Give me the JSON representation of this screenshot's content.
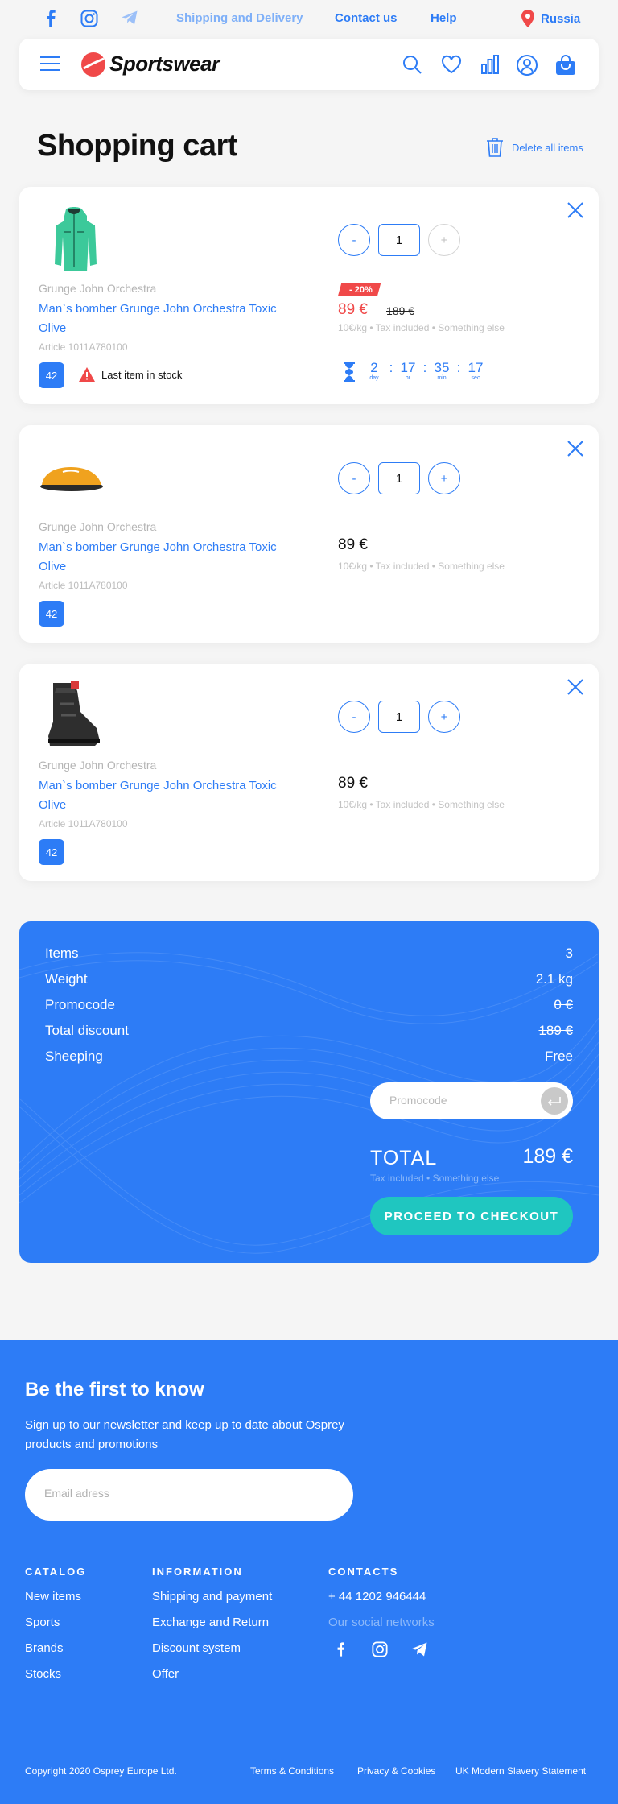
{
  "topbar": {
    "links": [
      "Shipping and Delivery",
      "Contact us",
      "Help"
    ],
    "region": "Russia",
    "social": [
      "facebook-icon",
      "instagram-icon",
      "telegram-icon"
    ]
  },
  "header": {
    "logo_text": "Sportswear",
    "icons": [
      "menu-icon",
      "search-icon",
      "heart-icon",
      "compare-icon",
      "user-icon",
      "bag-icon"
    ]
  },
  "page": {
    "title": "Shopping cart",
    "delete_all": "Delete all items"
  },
  "cart": {
    "items": [
      {
        "brand": "Grunge John Orchestra",
        "name": "Man`s bomber Grunge John Orchestra Toxic Olive",
        "article": "Article 1011A780100",
        "size": "42",
        "qty_minus": "-",
        "quantity": "1",
        "qty_plus": "+",
        "discount_badge": "- 20%",
        "price": "89 €",
        "old_price": "189 €",
        "price_info": "10€/kg • Tax included • Something else",
        "stock_note": "Last item in stock",
        "timer": {
          "day": "2",
          "hr": "17",
          "min": "35",
          "sec": "17",
          "day_label": "day",
          "hr_label": "hr",
          "min_label": "min",
          "sec_label": "sec",
          "sep": ":"
        }
      },
      {
        "brand": "Grunge John Orchestra",
        "name": "Man`s bomber Grunge John Orchestra Toxic Olive",
        "article": "Article 1011A780100",
        "size": "42",
        "qty_minus": "-",
        "quantity": "1",
        "qty_plus": "+",
        "price": "89 €",
        "price_info": "10€/kg • Tax included • Something else"
      },
      {
        "brand": "Grunge John Orchestra",
        "name": "Man`s bomber Grunge John Orchestra Toxic Olive",
        "article": "Article 1011A780100",
        "size": "42",
        "qty_minus": "-",
        "quantity": "1",
        "qty_plus": "+",
        "price": "89 €",
        "price_info": "10€/kg • Tax included • Something else"
      }
    ]
  },
  "summary": {
    "rows": [
      {
        "label": "Items",
        "value": "3"
      },
      {
        "label": "Weight",
        "value": "2.1 kg"
      },
      {
        "label": "Promocode",
        "value": "0 €"
      },
      {
        "label": "Total discount",
        "value": "189 €"
      },
      {
        "label": "Sheeping",
        "value": "Free"
      }
    ],
    "promo_placeholder": "Promocode",
    "total_label": "TOTAL",
    "total_value": "189 €",
    "tax_note": "Tax included • Something else",
    "checkout": "PROCEED TO CHECKOUT"
  },
  "footer": {
    "title": "Be the first to know",
    "text": "Sign up to our newsletter and keep up to date about Osprey products and promotions",
    "email_placeholder": "Email adress",
    "catalog": {
      "heading": "CATALOG",
      "links": [
        "New items",
        "Sports",
        "Brands",
        "Stocks"
      ]
    },
    "information": {
      "heading": "INFORMATION",
      "links": [
        "Shipping and payment",
        "Exchange and Return",
        "Discount system",
        "Offer"
      ]
    },
    "contacts": {
      "heading": "CONTACTS",
      "phone": "+ 44 1202 946444",
      "social_label": "Our social networks"
    },
    "copyright": "Copyright 2020 Osprey Europe Ltd.",
    "bottom_links": [
      "Terms & Conditions",
      "Privacy & Cookies",
      "UK Modern Slavery Statement"
    ]
  },
  "colors": {
    "accent": "#2d7cf6",
    "sale": "#f04949",
    "checkout": "#1fc6c0"
  }
}
